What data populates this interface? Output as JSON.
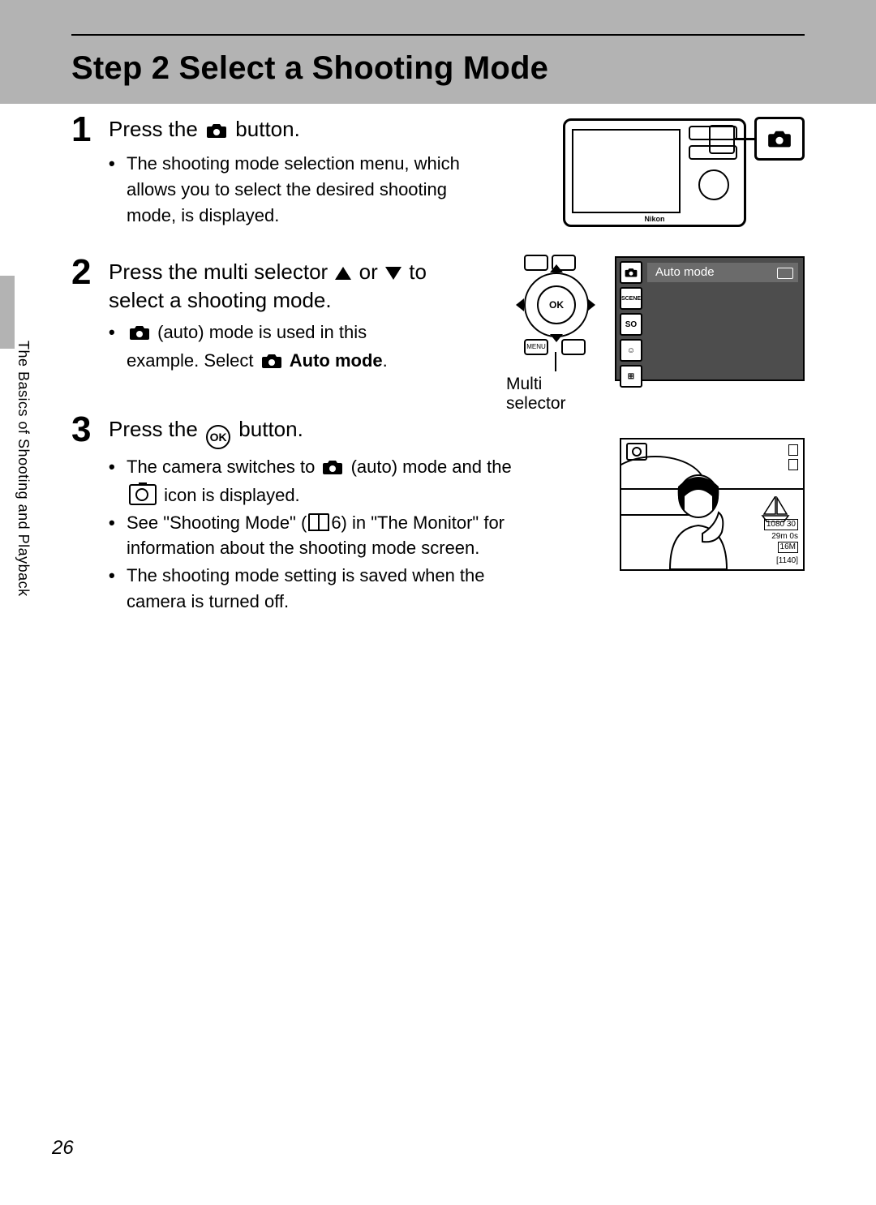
{
  "header": {
    "title": "Step 2 Select a Shooting Mode"
  },
  "sidebar_tab": "The Basics of Shooting and Playback",
  "page_number": "26",
  "steps": [
    {
      "num": "1",
      "heading_before": "Press the ",
      "heading_after": " button.",
      "bullets": [
        "The shooting mode selection menu, which allows you to select the desired shooting mode, is displayed."
      ]
    },
    {
      "num": "2",
      "heading": "Press the multi selector ▲ or ▼ to select a shooting mode.",
      "bullet_pre": " (auto) mode is used in this example. Select ",
      "bullet_bold": "Auto mode",
      "bullet_post": "."
    },
    {
      "num": "3",
      "heading_before": "Press the ",
      "heading_after": " button.",
      "bullets": [
        {
          "pre": "The camera switches to ",
          "mid": " (auto) mode and the ",
          "post": " icon is displayed."
        },
        {
          "pre": "See \"Shooting Mode\" (",
          "mid": "6) in \"The Monitor\" for information about the shooting mode screen.",
          "post": ""
        },
        {
          "pre": "The shooting mode setting is saved when the camera is turned off.",
          "mid": "",
          "post": ""
        }
      ]
    }
  ],
  "fig2": {
    "multi_selector_label": "Multi selector",
    "ok_label": "OK",
    "menu_label": "MENU",
    "mode_bar": "Auto mode",
    "mode_icons": [
      "📷",
      "SCENE",
      "SO",
      "☺",
      "⊞"
    ]
  },
  "fig3": {
    "video_badge": "1080 30",
    "time": "29m 0s",
    "size_badge": "16M",
    "count": "[1140]"
  },
  "camera_brand": "Nikon"
}
